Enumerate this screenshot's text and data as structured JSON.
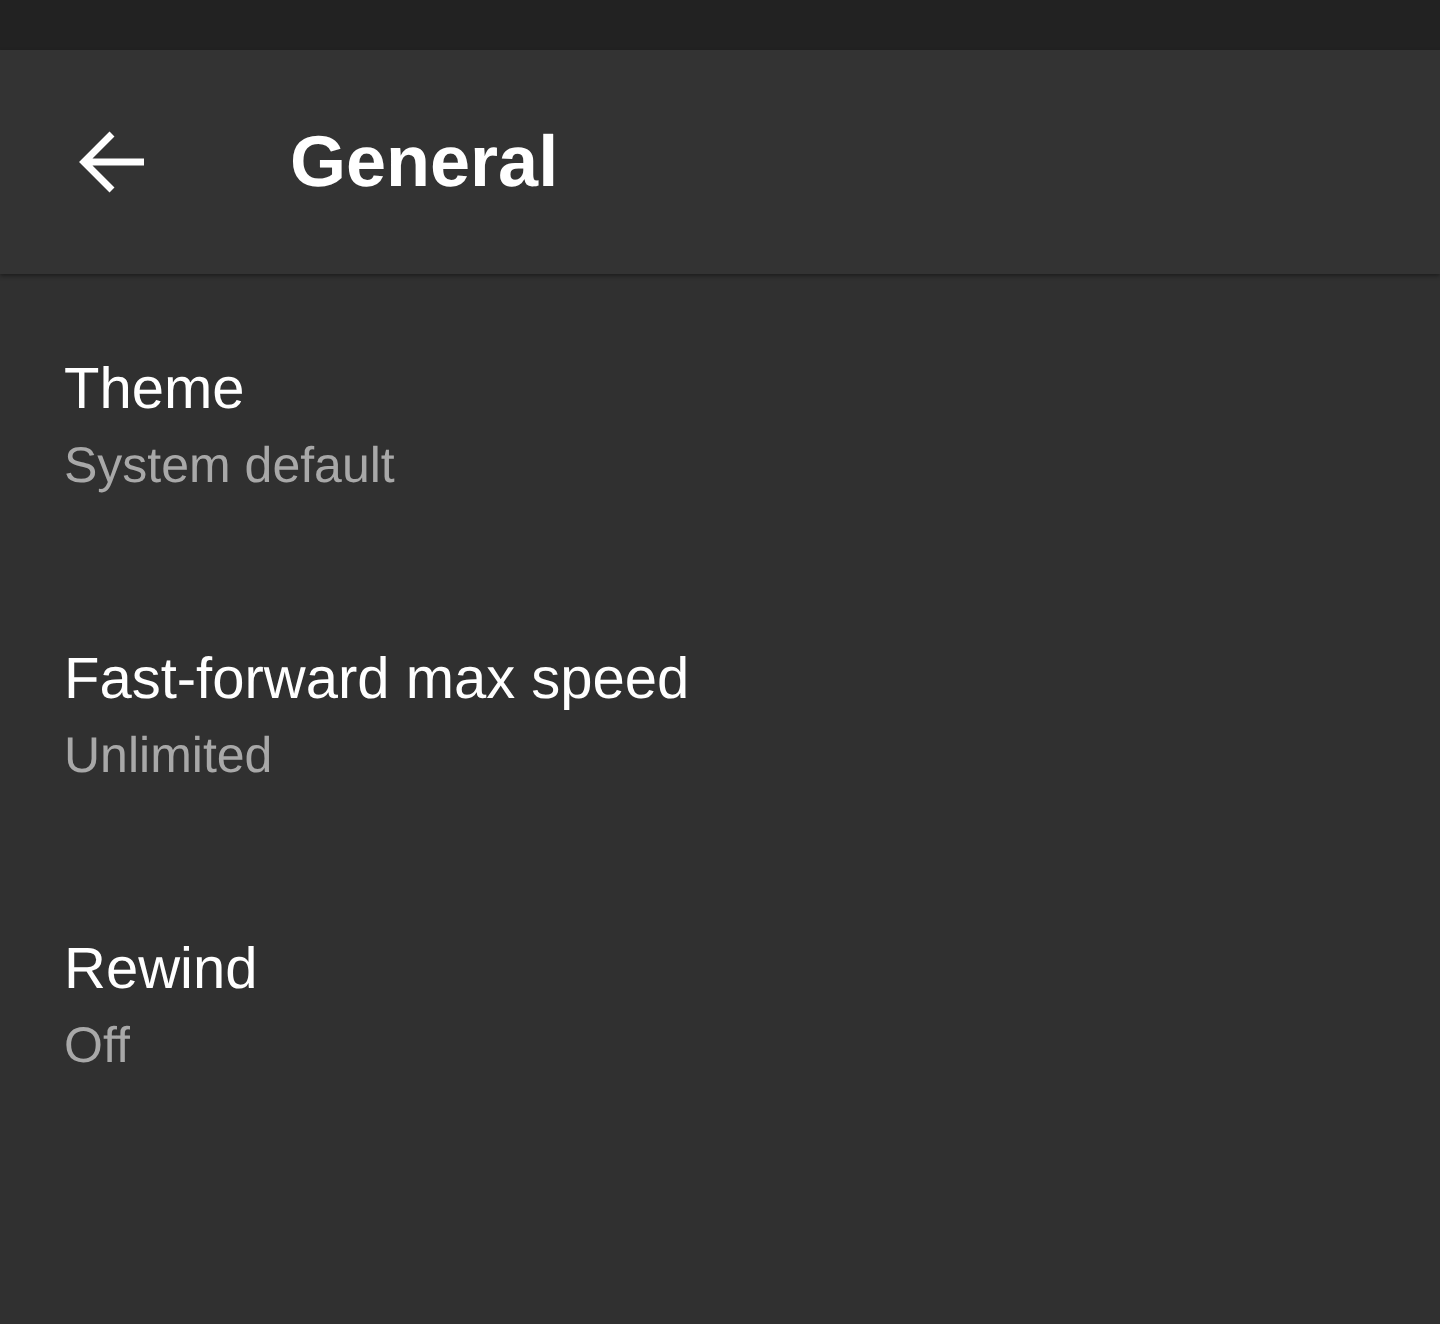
{
  "app_bar": {
    "title": "General"
  },
  "settings": [
    {
      "title": "Theme",
      "summary": "System default"
    },
    {
      "title": "Fast-forward max speed",
      "summary": "Unlimited"
    },
    {
      "title": "Rewind",
      "summary": "Off"
    }
  ]
}
